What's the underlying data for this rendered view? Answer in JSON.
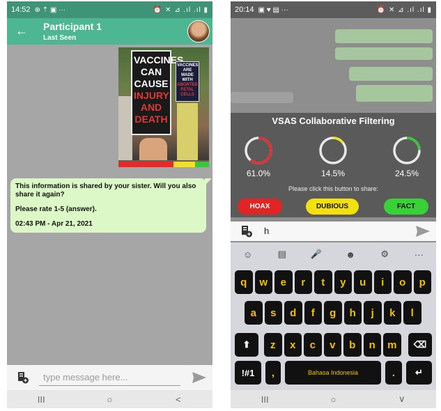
{
  "left_phone": {
    "status": {
      "time": "14:52",
      "left_icons": "⊕ ⇡ ▣ ···",
      "right_icons": "⏰ ✕ ⊿ .ıl .ıl ▮"
    },
    "header": {
      "name": "Participant 1",
      "status": "Last Seen"
    },
    "image_message": {
      "sign_main": [
        "VACCINES",
        "CAN",
        "CAUSE",
        "INJURY",
        "AND",
        "DEATH"
      ],
      "sign_small": [
        "VACCINES",
        "ARE MADE",
        "WITH",
        "ABORTED",
        "FETAL",
        "CELLS"
      ],
      "rating_colors": [
        "#e62a2a",
        "#f0e028",
        "#3cc43c"
      ],
      "rating_shares": [
        0.61,
        0.24,
        0.15
      ]
    },
    "message": {
      "line1": "This information is shared by your sister. Will you also share it again?",
      "line2": "Please rate 1-5 (answer).",
      "timestamp": "02:43 PM - Apr 21, 2021"
    },
    "input": {
      "placeholder": "type message here..."
    },
    "nav": {
      "recent": "III",
      "home": "○",
      "back": "<"
    }
  },
  "right_phone": {
    "status": {
      "time": "20:14",
      "left_icons": "▣ ♥ ▤ ···",
      "right_icons": "⏰ ✕ ⊿ .ıl .ıl ▮"
    },
    "vsas": {
      "title": "VSAS Collaborative Filtering",
      "gauges": [
        {
          "percent": "61.0%",
          "value": 61.0,
          "color": "#e23030"
        },
        {
          "percent": "14.5%",
          "value": 14.5,
          "color": "#f0e028"
        },
        {
          "percent": "24.5%",
          "value": 24.5,
          "color": "#3cc43c"
        }
      ],
      "note": "Please click this button to share:",
      "buttons": [
        {
          "label": "HOAX",
          "color": "#e22424",
          "text_color": "#ffffff"
        },
        {
          "label": "DUBIOUS",
          "color": "#f3e10e",
          "text_color": "#111111"
        },
        {
          "label": "FACT",
          "color": "#38d238",
          "text_color": "#111111"
        }
      ]
    },
    "compose": {
      "text": "h"
    },
    "keyboard": {
      "toolbar": [
        "☺",
        "▤",
        "🎤",
        "☻",
        "⚙",
        "···"
      ],
      "row1": [
        "q",
        "w",
        "e",
        "r",
        "t",
        "y",
        "u",
        "i",
        "o",
        "p"
      ],
      "row2": [
        "a",
        "s",
        "d",
        "f",
        "g",
        "h",
        "j",
        "k",
        "l"
      ],
      "row3": [
        "z",
        "x",
        "c",
        "v",
        "b",
        "n",
        "m"
      ],
      "shift": "⬆",
      "backspace": "⌫",
      "symbols": "!#1",
      "comma": ",",
      "space": "Bahasa Indonesia",
      "period": ".",
      "enter": "↵"
    },
    "nav": {
      "recent": "III",
      "home": "○",
      "back": "∨"
    }
  }
}
